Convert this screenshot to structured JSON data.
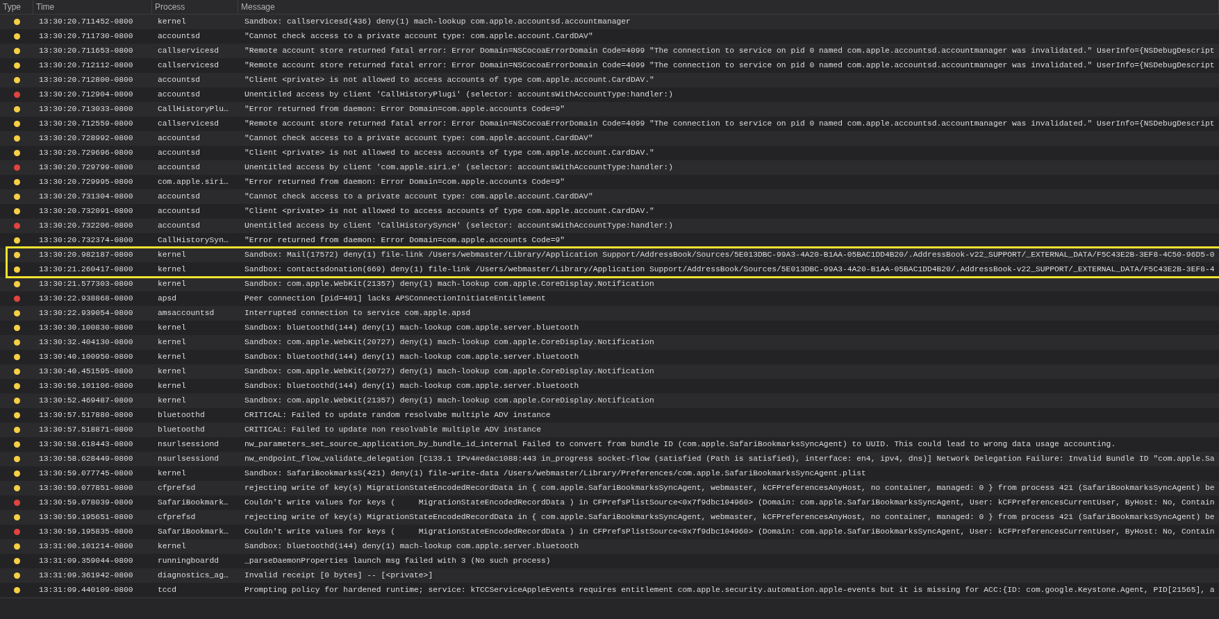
{
  "columns": [
    "Type",
    "Time",
    "Process",
    "Message"
  ],
  "rows": [
    {
      "color": "#f7cf46",
      "time": "13:30:20.711452-0800",
      "process": "kernel",
      "message": "Sandbox: callservicesd(436) deny(1) mach-lookup com.apple.accountsd.accountmanager",
      "highlighted": false
    },
    {
      "color": "#f7cf46",
      "time": "13:30:20.711730-0800",
      "process": "accountsd",
      "message": "\"Cannot check access to a private account type: com.apple.account.CardDAV\"",
      "highlighted": false
    },
    {
      "color": "#f7cf46",
      "time": "13:30:20.711653-0800",
      "process": "callservicesd",
      "message": "\"Remote account store returned fatal error: Error Domain=NSCocoaErrorDomain Code=4099 \"The connection to service on pid 0 named com.apple.accountsd.accountmanager was invalidated.\" UserInfo={NSDebugDescript",
      "highlighted": false
    },
    {
      "color": "#f7cf46",
      "time": "13:30:20.712112-0800",
      "process": "callservicesd",
      "message": "\"Remote account store returned fatal error: Error Domain=NSCocoaErrorDomain Code=4099 \"The connection to service on pid 0 named com.apple.accountsd.accountmanager was invalidated.\" UserInfo={NSDebugDescript",
      "highlighted": false
    },
    {
      "color": "#f7cf46",
      "time": "13:30:20.712800-0800",
      "process": "accountsd",
      "message": "\"Client <private> is not allowed to access accounts of type com.apple.account.CardDAV.\"",
      "highlighted": false
    },
    {
      "color": "#e0443e",
      "time": "13:30:20.712904-0800",
      "process": "accountsd",
      "message": "Unentitled access by client 'CallHistoryPlugi' (selector: accountsWithAccountType:handler:)",
      "highlighted": false
    },
    {
      "color": "#f7cf46",
      "time": "13:30:20.713033-0800",
      "process": "CallHistoryPlu…",
      "message": "\"Error returned from daemon: Error Domain=com.apple.accounts Code=9\"",
      "highlighted": false
    },
    {
      "color": "#f7cf46",
      "time": "13:30:20.712559-0800",
      "process": "callservicesd",
      "message": "\"Remote account store returned fatal error: Error Domain=NSCocoaErrorDomain Code=4099 \"The connection to service on pid 0 named com.apple.accountsd.accountmanager was invalidated.\" UserInfo={NSDebugDescript",
      "highlighted": false
    },
    {
      "color": "#f7cf46",
      "time": "13:30:20.728992-0800",
      "process": "accountsd",
      "message": "\"Cannot check access to a private account type: com.apple.account.CardDAV\"",
      "highlighted": false
    },
    {
      "color": "#f7cf46",
      "time": "13:30:20.729696-0800",
      "process": "accountsd",
      "message": "\"Client <private> is not allowed to access accounts of type com.apple.account.CardDAV.\"",
      "highlighted": false
    },
    {
      "color": "#e0443e",
      "time": "13:30:20.729799-0800",
      "process": "accountsd",
      "message": "Unentitled access by client 'com.apple.siri.e' (selector: accountsWithAccountType:handler:)",
      "highlighted": false
    },
    {
      "color": "#f7cf46",
      "time": "13:30:20.729995-0800",
      "process": "com.apple.siri…",
      "message": "\"Error returned from daemon: Error Domain=com.apple.accounts Code=9\"",
      "highlighted": false
    },
    {
      "color": "#f7cf46",
      "time": "13:30:20.731304-0800",
      "process": "accountsd",
      "message": "\"Cannot check access to a private account type: com.apple.account.CardDAV\"",
      "highlighted": false
    },
    {
      "color": "#f7cf46",
      "time": "13:30:20.732091-0800",
      "process": "accountsd",
      "message": "\"Client <private> is not allowed to access accounts of type com.apple.account.CardDAV.\"",
      "highlighted": false
    },
    {
      "color": "#e0443e",
      "time": "13:30:20.732206-0800",
      "process": "accountsd",
      "message": "Unentitled access by client 'CallHistorySyncH' (selector: accountsWithAccountType:handler:)",
      "highlighted": false
    },
    {
      "color": "#f7cf46",
      "time": "13:30:20.732374-0800",
      "process": "CallHistorySyn…",
      "message": "\"Error returned from daemon: Error Domain=com.apple.accounts Code=9\"",
      "highlighted": false
    },
    {
      "color": "#f7cf46",
      "time": "13:30:20.982187-0800",
      "process": "kernel",
      "message": "Sandbox: Mail(17572) deny(1) file-link /Users/webmaster/Library/Application Support/AddressBook/Sources/5E013DBC-99A3-4A20-B1AA-05BAC1DD4B20/.AddressBook-v22_SUPPORT/_EXTERNAL_DATA/F5C43E2B-3EF8-4C50-96D5-0",
      "highlighted": true
    },
    {
      "color": "#f7cf46",
      "time": "13:30:21.260417-0800",
      "process": "kernel",
      "message": "Sandbox: contactsdonation(669) deny(1) file-link /Users/webmaster/Library/Application Support/AddressBook/Sources/5E013DBC-99A3-4A20-B1AA-05BAC1DD4B20/.AddressBook-v22_SUPPORT/_EXTERNAL_DATA/F5C43E2B-3EF8-4",
      "highlighted": true
    },
    {
      "color": "#f7cf46",
      "time": "13:30:21.577303-0800",
      "process": "kernel",
      "message": "Sandbox: com.apple.WebKit(21357) deny(1) mach-lookup com.apple.CoreDisplay.Notification",
      "highlighted": false
    },
    {
      "color": "#e0443e",
      "time": "13:30:22.938868-0800",
      "process": "apsd",
      "message": "Peer connection [pid=401] lacks APSConnectionInitiateEntitlement",
      "highlighted": false
    },
    {
      "color": "#f7cf46",
      "time": "13:30:22.939054-0800",
      "process": "amsaccountsd",
      "message": "Interrupted connection to service com.apple.apsd",
      "highlighted": false
    },
    {
      "color": "#f7cf46",
      "time": "13:30:30.100830-0800",
      "process": "kernel",
      "message": "Sandbox: bluetoothd(144) deny(1) mach-lookup com.apple.server.bluetooth",
      "highlighted": false
    },
    {
      "color": "#f7cf46",
      "time": "13:30:32.404130-0800",
      "process": "kernel",
      "message": "Sandbox: com.apple.WebKit(20727) deny(1) mach-lookup com.apple.CoreDisplay.Notification",
      "highlighted": false
    },
    {
      "color": "#f7cf46",
      "time": "13:30:40.100950-0800",
      "process": "kernel",
      "message": "Sandbox: bluetoothd(144) deny(1) mach-lookup com.apple.server.bluetooth",
      "highlighted": false
    },
    {
      "color": "#f7cf46",
      "time": "13:30:40.451595-0800",
      "process": "kernel",
      "message": "Sandbox: com.apple.WebKit(20727) deny(1) mach-lookup com.apple.CoreDisplay.Notification",
      "highlighted": false
    },
    {
      "color": "#f7cf46",
      "time": "13:30:50.101106-0800",
      "process": "kernel",
      "message": "Sandbox: bluetoothd(144) deny(1) mach-lookup com.apple.server.bluetooth",
      "highlighted": false
    },
    {
      "color": "#f7cf46",
      "time": "13:30:52.469487-0800",
      "process": "kernel",
      "message": "Sandbox: com.apple.WebKit(21357) deny(1) mach-lookup com.apple.CoreDisplay.Notification",
      "highlighted": false
    },
    {
      "color": "#f7cf46",
      "time": "13:30:57.517880-0800",
      "process": "bluetoothd",
      "message": "CRITICAL: Failed to update random resolvabe multiple ADV instance",
      "highlighted": false
    },
    {
      "color": "#f7cf46",
      "time": "13:30:57.518871-0800",
      "process": "bluetoothd",
      "message": "CRITICAL: Failed to update non resolvable multiple ADV instance",
      "highlighted": false
    },
    {
      "color": "#f7cf46",
      "time": "13:30:58.618443-0800",
      "process": "nsurlsessiond",
      "message": "nw_parameters_set_source_application_by_bundle_id_internal Failed to convert from bundle ID (com.apple.SafariBookmarksSyncAgent) to UUID. This could lead to wrong data usage accounting.",
      "highlighted": false
    },
    {
      "color": "#f7cf46",
      "time": "13:30:58.628449-0800",
      "process": "nsurlsessiond",
      "message": "nw_endpoint_flow_validate_delegation [C133.1 IPv4#edac1088:443 in_progress socket-flow (satisfied (Path is satisfied), interface: en4, ipv4, dns)] Network Delegation Failure: Invalid Bundle ID \"com.apple.Sa",
      "highlighted": false
    },
    {
      "color": "#f7cf46",
      "time": "13:30:59.077745-0800",
      "process": "kernel",
      "message": "Sandbox: SafariBookmarksS(421) deny(1) file-write-data /Users/webmaster/Library/Preferences/com.apple.SafariBookmarksSyncAgent.plist",
      "highlighted": false
    },
    {
      "color": "#f7cf46",
      "time": "13:30:59.077851-0800",
      "process": "cfprefsd",
      "message": "rejecting write of key(s) MigrationStateEncodedRecordData in { com.apple.SafariBookmarksSyncAgent, webmaster, kCFPreferencesAnyHost, no container, managed: 0 } from process 421 (SafariBookmarksSyncAgent) be",
      "highlighted": false
    },
    {
      "color": "#e0443e",
      "time": "13:30:59.078039-0800",
      "process": "SafariBookmark…",
      "message": "Couldn't write values for keys (     MigrationStateEncodedRecordData ) in CFPrefsPlistSource<0x7f9dbc104960> (Domain: com.apple.SafariBookmarksSyncAgent, User: kCFPreferencesCurrentUser, ByHost: No, Contain",
      "highlighted": false
    },
    {
      "color": "#f7cf46",
      "time": "13:30:59.195651-0800",
      "process": "cfprefsd",
      "message": "rejecting write of key(s) MigrationStateEncodedRecordData in { com.apple.SafariBookmarksSyncAgent, webmaster, kCFPreferencesAnyHost, no container, managed: 0 } from process 421 (SafariBookmarksSyncAgent) be",
      "highlighted": false
    },
    {
      "color": "#e0443e",
      "time": "13:30:59.195835-0800",
      "process": "SafariBookmark…",
      "message": "Couldn't write values for keys (     MigrationStateEncodedRecordData ) in CFPrefsPlistSource<0x7f9dbc104960> (Domain: com.apple.SafariBookmarksSyncAgent, User: kCFPreferencesCurrentUser, ByHost: No, Contain",
      "highlighted": false
    },
    {
      "color": "#f7cf46",
      "time": "13:31:00.101214-0800",
      "process": "kernel",
      "message": "Sandbox: bluetoothd(144) deny(1) mach-lookup com.apple.server.bluetooth",
      "highlighted": false
    },
    {
      "color": "#f7cf46",
      "time": "13:31:09.359044-0800",
      "process": "runningboardd",
      "message": "_parseDaemonProperties launch msg failed with 3 (No such process)",
      "highlighted": false
    },
    {
      "color": "#f7cf46",
      "time": "13:31:09.361942-0800",
      "process": "diagnostics_ag…",
      "message": "Invalid receipt [0 bytes] -- [<private>]",
      "highlighted": false
    },
    {
      "color": "#f7cf46",
      "time": "13:31:09.440109-0800",
      "process": "tccd",
      "message": "Prompting policy for hardened runtime; service: kTCCServiceAppleEvents requires entitlement com.apple.security.automation.apple-events but it is missing for ACC:{ID: com.google.Keystone.Agent, PID[21565], a",
      "highlighted": false
    }
  ]
}
